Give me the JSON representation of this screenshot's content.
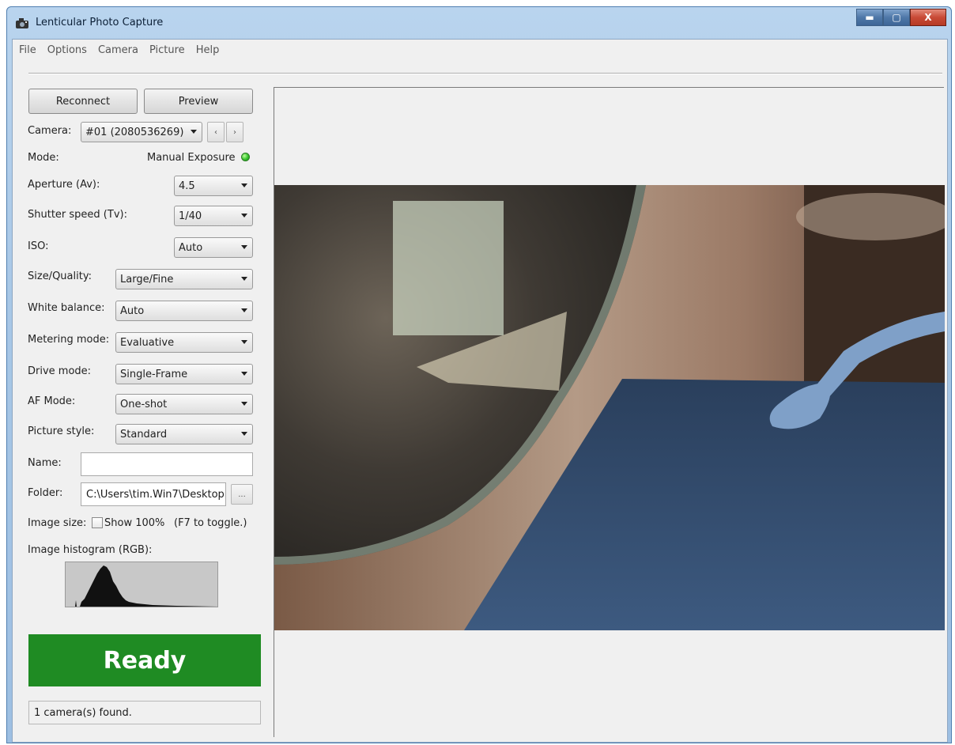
{
  "window": {
    "title": "Lenticular Photo Capture",
    "controls": {
      "minimize": "▬",
      "maximize": "▢",
      "close": "X"
    }
  },
  "menu": [
    "File",
    "Options",
    "Camera",
    "Picture",
    "Help"
  ],
  "buttons": {
    "reconnect": "Reconnect",
    "preview": "Preview",
    "browse": "...",
    "prev": "‹",
    "next": "›"
  },
  "camera": {
    "label": "Camera:",
    "value": "#01 (2080536269)"
  },
  "mode": {
    "label": "Mode:",
    "value": "Manual Exposure",
    "indicator_color": "#35c22c"
  },
  "settings": {
    "aperture": {
      "label": "Aperture (Av):",
      "value": "4.5"
    },
    "shutter": {
      "label": "Shutter speed (Tv):",
      "value": "1/40"
    },
    "iso": {
      "label": "ISO:",
      "value": "Auto"
    },
    "size_quality": {
      "label": "Size/Quality:",
      "value": "Large/Fine"
    },
    "white_balance": {
      "label": "White balance:",
      "value": "Auto"
    },
    "metering": {
      "label": "Metering mode:",
      "value": "Evaluative"
    },
    "drive": {
      "label": "Drive mode:",
      "value": "Single-Frame"
    },
    "af": {
      "label": "AF Mode:",
      "value": "One-shot"
    },
    "picture_style": {
      "label": "Picture style:",
      "value": "Standard"
    }
  },
  "name": {
    "label": "Name:",
    "value": ""
  },
  "folder": {
    "label": "Folder:",
    "value": "C:\\Users\\tim.Win7\\Desktop"
  },
  "image_size": {
    "label": "Image size:",
    "checkbox_label": "Show 100%",
    "hint": "(F7 to toggle.)",
    "checked": false
  },
  "histogram": {
    "label": "Image histogram (RGB):"
  },
  "status": {
    "main": "Ready",
    "main_color": "#1f8b23",
    "bar": "1 camera(s) found."
  }
}
